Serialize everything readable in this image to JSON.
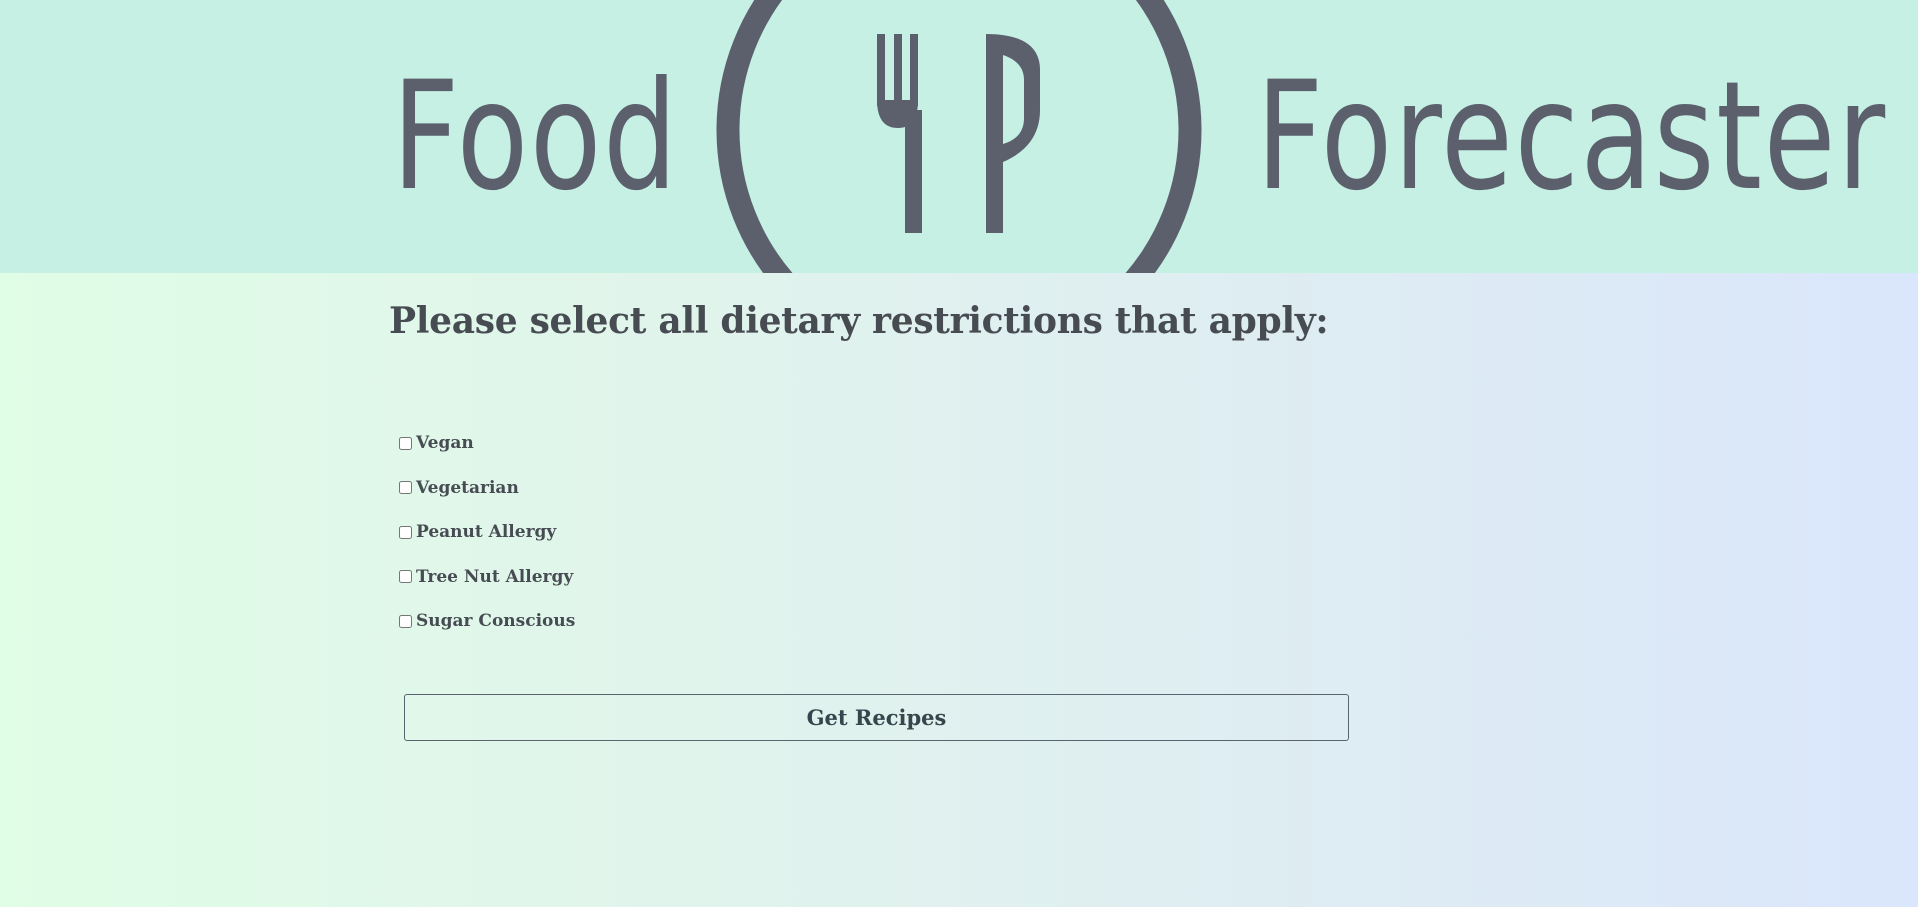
{
  "header": {
    "logo_word_left": "Food",
    "logo_word_right": "Forecaster",
    "logo_icon": "fork-knife-plate-icon",
    "banner_color": "#c6f0e4",
    "logo_color": "#5b606c"
  },
  "form": {
    "heading": "Please select all dietary restrictions that apply:",
    "options": [
      {
        "label": "Vegan",
        "checked": false
      },
      {
        "label": "Vegetarian",
        "checked": false
      },
      {
        "label": "Peanut Allergy",
        "checked": false
      },
      {
        "label": "Tree Nut Allergy",
        "checked": false
      },
      {
        "label": "Sugar Conscious",
        "checked": false
      }
    ],
    "submit_label": "Get Recipes"
  }
}
